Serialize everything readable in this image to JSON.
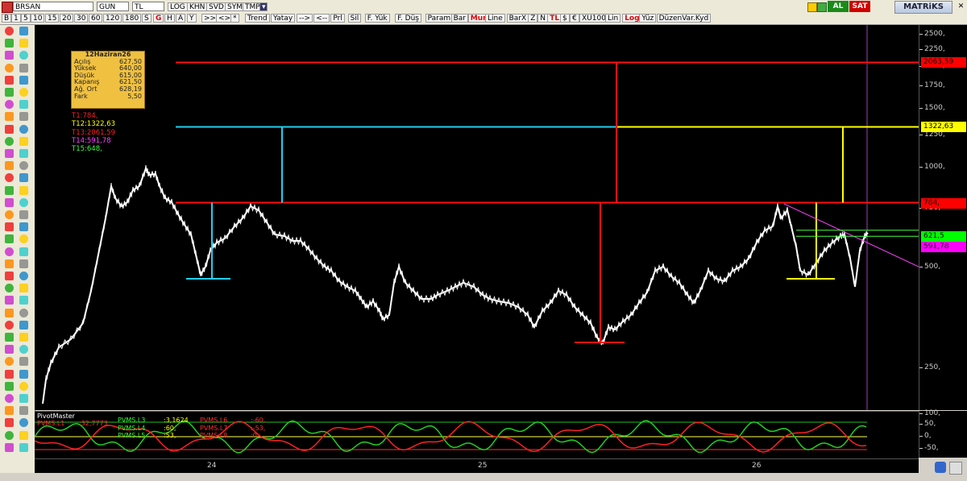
{
  "toolbar1": {
    "symbol": "BRSAN",
    "period": "GUN",
    "currency": "TL",
    "buttons": [
      "LOG",
      "KHN",
      "SVD",
      "SYM",
      "TMP"
    ],
    "al_label": "AL",
    "sat_label": "SAT",
    "app_name": "MATRiKS"
  },
  "toolbar2": {
    "intervals": [
      "B",
      "1",
      "5",
      "10",
      "15",
      "20",
      "30",
      "60",
      "120",
      "180",
      "S"
    ],
    "nav": [
      "G",
      "H",
      "A",
      "Y"
    ],
    "zoom": [
      ">>",
      "<>",
      "*"
    ],
    "tools": [
      "Trend",
      "Yatay",
      "-->",
      "<--",
      "Prl",
      "Sil",
      "F. Yük",
      "F. Düş",
      "Param",
      "Bar",
      "Mum",
      "Line",
      "BarX",
      "Z",
      "N",
      "TL",
      "$",
      "€",
      "XU100",
      "Lin",
      "Log",
      "Yüz",
      "DüzenVar.Kyd"
    ]
  },
  "infobox": {
    "date": "12Haziran26",
    "rows": [
      {
        "label": "Açılış",
        "value": "627,50"
      },
      {
        "label": "Yüksek",
        "value": "640,00"
      },
      {
        "label": "Düşük",
        "value": "615,00"
      },
      {
        "label": "Kapanış",
        "value": "621,50"
      },
      {
        "label": "Ağ. Ort",
        "value": "628,19"
      },
      {
        "label": "Fark",
        "value": "5,50"
      }
    ]
  },
  "target_labels": [
    {
      "text": "T1:784,",
      "color": "#ff2020"
    },
    {
      "text": "T12:1322,63",
      "color": "#ffff00"
    },
    {
      "text": "T13:2061,59",
      "color": "#ff2020"
    },
    {
      "text": "T14:591,78",
      "color": "#ff40ff"
    },
    {
      "text": "T15:648,",
      "color": "#40ff40"
    }
  ],
  "y_axis": {
    "ticks": [
      "2500,",
      "2250,",
      "2000,",
      "1750,",
      "1500,",
      "1250,",
      "1000,",
      "750,",
      "500,",
      "250,"
    ],
    "tags": [
      {
        "text": "2063,59",
        "bg": "#ff0000",
        "fg": "#000000"
      },
      {
        "text": "1322,63",
        "bg": "#ffff00",
        "fg": "#000000"
      },
      {
        "text": "784,",
        "bg": "#ff0000",
        "fg": "#000000"
      },
      {
        "text": "621,5",
        "bg": "#00ff00",
        "fg": "#000000"
      },
      {
        "text": "591,78",
        "bg": "#ff00ff",
        "fg": "#000000"
      }
    ]
  },
  "indicator": {
    "name": "PivotMaster",
    "labels": [
      {
        "text": "PVMS.L1",
        "color": "#ff3030"
      },
      {
        "text": ":32,7773",
        "color": "#ff3030"
      },
      {
        "text": "PVMS.L3",
        "color": "#30ff30"
      },
      {
        "text": ":3,1624",
        "color": "#ffff00"
      },
      {
        "text": "PVMS.L6",
        "color": "#ff3030"
      },
      {
        "text": ":-60,",
        "color": "#ff3030"
      },
      {
        "text": "PVMS.L4",
        "color": "#30ff30"
      },
      {
        "text": ":60,",
        "color": "#ffff00"
      },
      {
        "text": "PVMS.L7",
        "color": "#ff3030"
      },
      {
        "text": ":-53,",
        "color": "#ff3030"
      },
      {
        "text": "PVMS.L5",
        "color": "#30ff30"
      },
      {
        "text": ":53,",
        "color": "#ffff00"
      },
      {
        "text": "PVMS.L8",
        "color": "#ff3030"
      },
      {
        "text": ":0,",
        "color": "#ff3030"
      }
    ],
    "ticks": [
      "100,",
      "50,",
      "0,",
      "-50,"
    ]
  },
  "x_axis": {
    "ticks": [
      "24",
      "25",
      "26"
    ]
  }
}
